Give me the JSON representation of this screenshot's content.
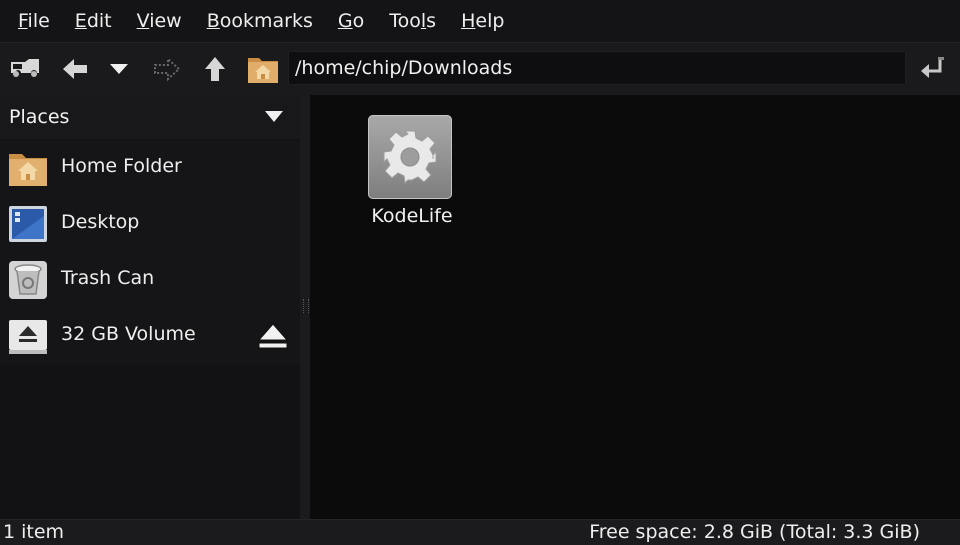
{
  "menu": {
    "file": {
      "u": "F",
      "rest": "ile"
    },
    "edit": {
      "u": "E",
      "rest": "dit"
    },
    "view": {
      "u": "V",
      "rest": "iew"
    },
    "bookmarks": {
      "u": "B",
      "rest": "ookmarks"
    },
    "go": {
      "u": "G",
      "rest": "o"
    },
    "tools": {
      "pre": "Too",
      "u": "l",
      "rest": "s"
    },
    "help": {
      "u": "H",
      "rest": "elp"
    }
  },
  "toolbar": {
    "icons": [
      "computer-icon",
      "back-arrow-icon",
      "history-dropdown-icon",
      "forward-arrow-icon",
      "up-arrow-icon",
      "home-folder-icon",
      "go-return-icon"
    ],
    "path": "/home/chip/Downloads"
  },
  "sidebar": {
    "title": "Places",
    "items": [
      {
        "label": "Home Folder",
        "icon": "home-folder-icon"
      },
      {
        "label": "Desktop",
        "icon": "desktop-icon"
      },
      {
        "label": "Trash Can",
        "icon": "trash-can-icon"
      },
      {
        "label": "32 GB Volume",
        "icon": "drive-icon"
      }
    ]
  },
  "files": [
    {
      "name": "KodeLife",
      "icon": "gear-icon"
    }
  ],
  "status": {
    "count": "1 item",
    "space": "Free space: 2.8 GiB (Total: 3.3 GiB)"
  },
  "colors": {
    "background": "#0c0c0e",
    "folder": "#d9a35a",
    "desktop": "#2b5aa8",
    "text": "#eeeeee"
  }
}
